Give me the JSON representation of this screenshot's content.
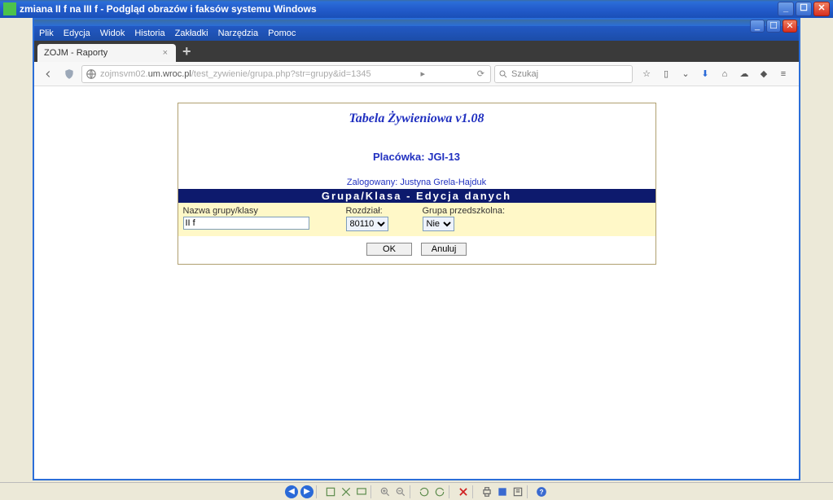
{
  "window": {
    "title": "zmiana II f na III f - Podgląd obrazów i faksów systemu Windows"
  },
  "menu": {
    "items": [
      "Plik",
      "Edycja",
      "Widok",
      "Historia",
      "Zakładki",
      "Narzędzia",
      "Pomoc"
    ]
  },
  "tab": {
    "label": "ZOJM - Raporty"
  },
  "url": {
    "host": "zojmsvm02.um.wroc.pl",
    "path": "/test_zywienie/grupa.php?str=grupy&id=1345"
  },
  "search": {
    "placeholder": "Szukaj"
  },
  "page": {
    "app_title": "Tabela Żywieniowa v1.08",
    "place_label": "Placówka: JGI-13",
    "logged": "Zalogowany: Justyna Grela-Hajduk",
    "section": "Grupa/Klasa - Edycja danych",
    "field_group_label": "Nazwa grupy/klasy",
    "field_group_value": "II f",
    "field_rozdzial_label": "Rozdział:",
    "field_rozdzial_value": "80110",
    "field_przedszk_label": "Grupa przedszkolna:",
    "field_przedszk_value": "Nie",
    "ok": "OK",
    "cancel": "Anuluj"
  }
}
